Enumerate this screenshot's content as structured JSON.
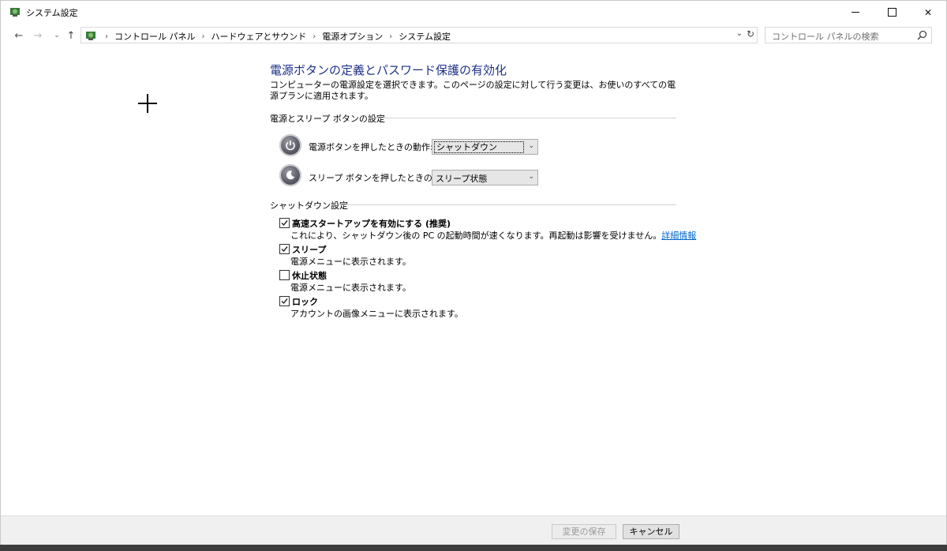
{
  "window": {
    "title": "システム設定"
  },
  "nav": {
    "breadcrumbs": [
      "コントロール パネル",
      "ハードウェアとサウンド",
      "電源オプション",
      "システム設定"
    ],
    "search_placeholder": "コントロール パネルの検索"
  },
  "content": {
    "heading": "電源ボタンの定義とパスワード保護の有効化",
    "description": "コンピューターの電源設定を選択できます。このページの設定に対して行う変更は、お使いのすべての電源プランに適用されます。",
    "power_section": {
      "title": "電源とスリープ ボタンの設定",
      "power_button_label": "電源ボタンを押したときの動作:",
      "power_button_value": "シャットダウン",
      "sleep_button_label": "スリープ ボタンを押したときの動作:",
      "sleep_button_value": "スリープ状態"
    },
    "shutdown_section": {
      "title": "シャットダウン設定",
      "options": [
        {
          "label": "高速スタートアップを有効にする (推奨)",
          "description": "これにより、シャットダウン後の PC の起動時間が速くなります。再起動は影響を受けません。",
          "link": "詳細情報",
          "checked": true
        },
        {
          "label": "スリープ",
          "description": "電源メニューに表示されます。",
          "checked": true
        },
        {
          "label": "休止状態",
          "description": "電源メニューに表示されます。",
          "checked": false
        },
        {
          "label": "ロック",
          "description": "アカウントの画像メニューに表示されます。",
          "checked": true
        }
      ]
    }
  },
  "footer": {
    "save_label": "変更の保存",
    "cancel_label": "キャンセル"
  },
  "colors": {
    "heading": "#1e3287",
    "link": "#0066cc"
  }
}
